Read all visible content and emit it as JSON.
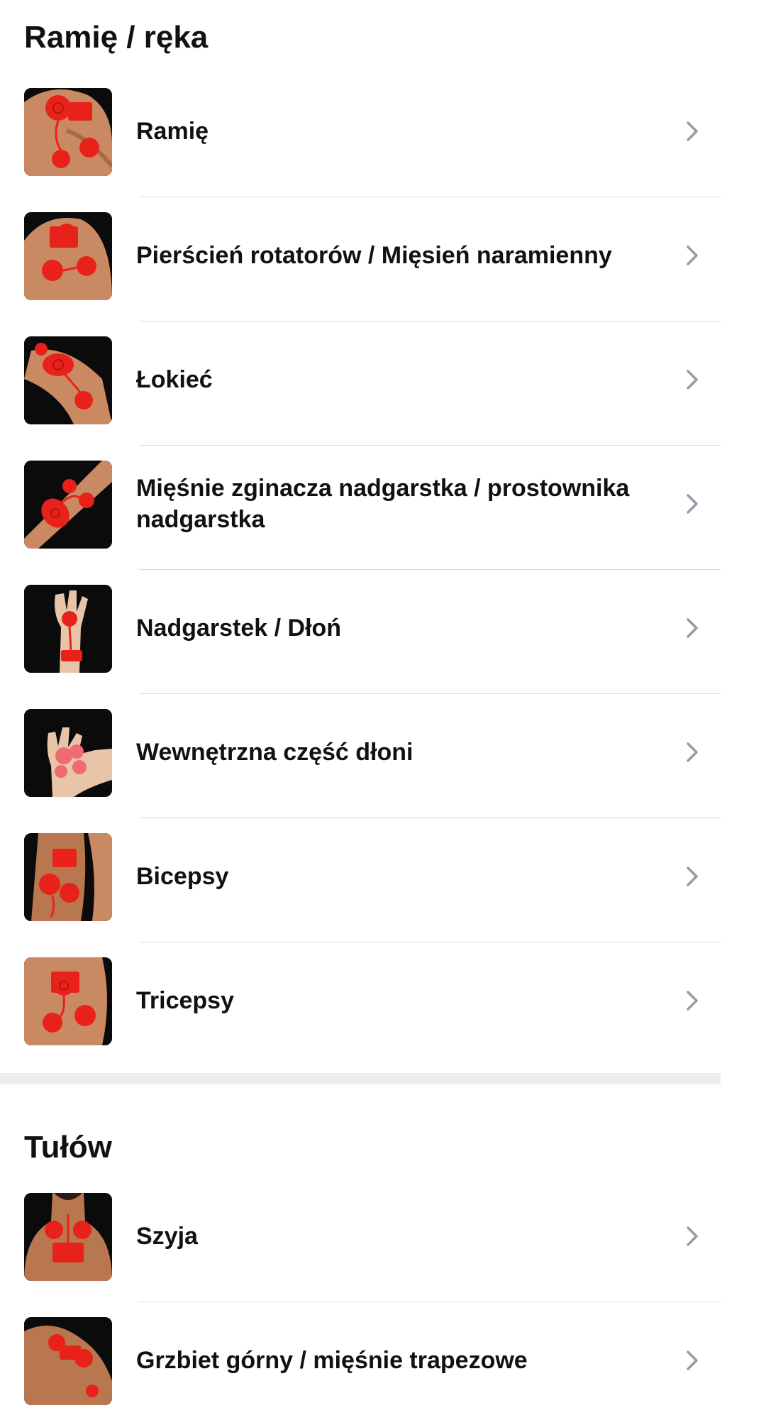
{
  "sections": [
    {
      "title": "Ramię / ręka",
      "items": [
        {
          "label": "Ramię",
          "icon": "shoulder-electrode-photo"
        },
        {
          "label": "Pierścień rotatorów / Mięsień naramienny",
          "icon": "rotator-cuff-electrode-photo"
        },
        {
          "label": "Łokieć",
          "icon": "elbow-electrode-photo"
        },
        {
          "label": "Mięśnie zginacza nadgarstka / prostownika nadgarstka",
          "icon": "forearm-electrode-photo"
        },
        {
          "label": "Nadgarstek / Dłoń",
          "icon": "wrist-hand-electrode-photo"
        },
        {
          "label": "Wewnętrzna część dłoni",
          "icon": "palm-electrode-photo"
        },
        {
          "label": "Bicepsy",
          "icon": "biceps-electrode-photo"
        },
        {
          "label": "Tricepsy",
          "icon": "triceps-electrode-photo"
        }
      ]
    },
    {
      "title": "Tułów",
      "items": [
        {
          "label": "Szyja",
          "icon": "neck-electrode-photo"
        },
        {
          "label": "Grzbiet górny / mięśnie trapezowe",
          "icon": "upper-back-electrode-photo"
        }
      ]
    }
  ],
  "colors": {
    "electrode_red": "#e8221b",
    "skin": "#c98a63",
    "photo_bg": "#0b0b0b",
    "chevron": "#9a9aa6",
    "divider": "#dddddd",
    "section_separator": "#ececec"
  },
  "chevron_icon": "chevron-right-icon"
}
